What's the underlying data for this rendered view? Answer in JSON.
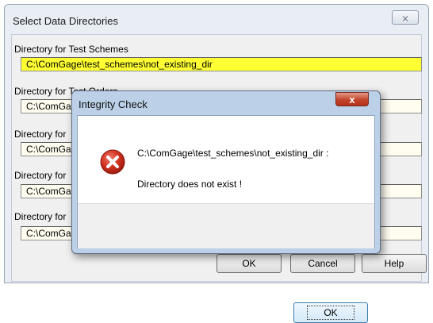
{
  "window": {
    "title": "Select Data Directories",
    "close_glyph": "⨯"
  },
  "fields": [
    {
      "label": "Directory for Test Schemes",
      "value": "C:\\ComGage\\test_schemes\\not_existing_dir"
    },
    {
      "label": "Directory for Test Orders",
      "value": "C:\\ComGa"
    },
    {
      "label": "Directory for",
      "value": "C:\\ComGa"
    },
    {
      "label": "Directory for",
      "value": "C:\\ComGa"
    },
    {
      "label": "Directory for",
      "value": "C:\\ComGa"
    }
  ],
  "buttons": {
    "ok": "OK",
    "cancel": "Cancel",
    "help": "Help"
  },
  "dialog": {
    "title": "Integrity Check",
    "close_glyph": "x",
    "path": "C:\\ComGage\\test_schemes\\not_existing_dir :",
    "message": "Directory does not exist !",
    "ok": "OK",
    "icon": "error-icon"
  },
  "colors": {
    "active_field": "#ffff33",
    "inactive_field": "#fffdf0",
    "dialog_frame": "#bcd0e8",
    "error_red": "#c8281e"
  }
}
